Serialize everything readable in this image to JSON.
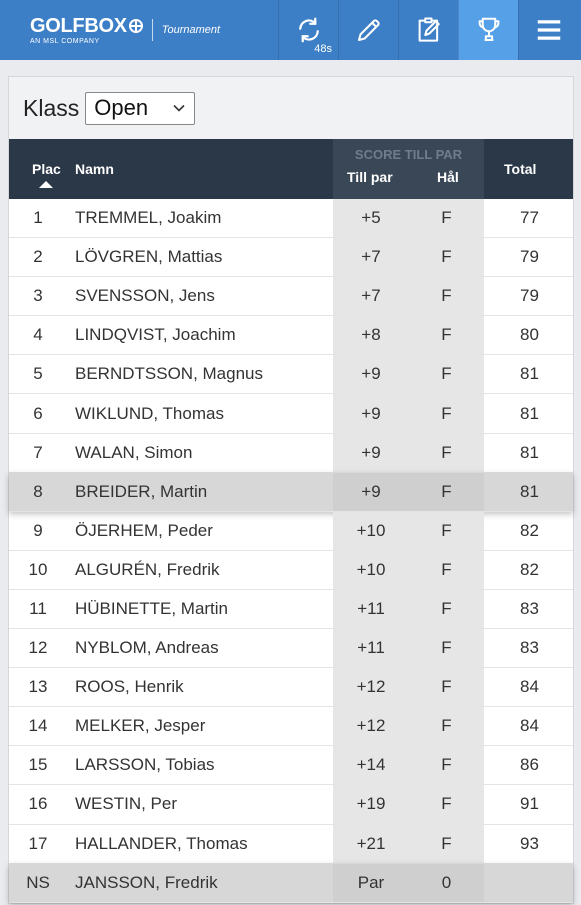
{
  "header": {
    "brand_name": "GOLFBOX",
    "brand_sub": "AN MSL COMPANY",
    "product": "Tournament",
    "refresh_count": "48s"
  },
  "filter": {
    "label": "Klass",
    "selected": "Open"
  },
  "table": {
    "columns": {
      "plac": "Plac",
      "namn": "Namn",
      "group": "SCORE TILL PAR",
      "till_par": "Till par",
      "hal": "Hål",
      "total": "Total"
    },
    "rows": [
      {
        "place": "1",
        "name": "TREMMEL, Joakim",
        "to_par": "+5",
        "hole": "F",
        "total": "77"
      },
      {
        "place": "2",
        "name": "LÖVGREN, Mattias",
        "to_par": "+7",
        "hole": "F",
        "total": "79"
      },
      {
        "place": "3",
        "name": "SVENSSON, Jens",
        "to_par": "+7",
        "hole": "F",
        "total": "79"
      },
      {
        "place": "4",
        "name": "LINDQVIST, Joachim",
        "to_par": "+8",
        "hole": "F",
        "total": "80"
      },
      {
        "place": "5",
        "name": "BERNDTSSON, Magnus",
        "to_par": "+9",
        "hole": "F",
        "total": "81"
      },
      {
        "place": "6",
        "name": "WIKLUND, Thomas",
        "to_par": "+9",
        "hole": "F",
        "total": "81"
      },
      {
        "place": "7",
        "name": "WALAN, Simon",
        "to_par": "+9",
        "hole": "F",
        "total": "81"
      },
      {
        "place": "8",
        "name": "BREIDER, Martin",
        "to_par": "+9",
        "hole": "F",
        "total": "81"
      },
      {
        "place": "9",
        "name": "ÖJERHEM, Peder",
        "to_par": "+10",
        "hole": "F",
        "total": "82"
      },
      {
        "place": "10",
        "name": "ALGURÉN, Fredrik",
        "to_par": "+10",
        "hole": "F",
        "total": "82"
      },
      {
        "place": "11",
        "name": "HÜBINETTE, Martin",
        "to_par": "+11",
        "hole": "F",
        "total": "83"
      },
      {
        "place": "12",
        "name": "NYBLOM, Andreas",
        "to_par": "+11",
        "hole": "F",
        "total": "83"
      },
      {
        "place": "13",
        "name": "ROOS, Henrik",
        "to_par": "+12",
        "hole": "F",
        "total": "84"
      },
      {
        "place": "14",
        "name": "MELKER, Jesper",
        "to_par": "+12",
        "hole": "F",
        "total": "84"
      },
      {
        "place": "15",
        "name": "LARSSON, Tobias",
        "to_par": "+14",
        "hole": "F",
        "total": "86"
      },
      {
        "place": "16",
        "name": "WESTIN, Per",
        "to_par": "+19",
        "hole": "F",
        "total": "91"
      },
      {
        "place": "17",
        "name": "HALLANDER, Thomas",
        "to_par": "+21",
        "hole": "F",
        "total": "93"
      },
      {
        "place": "NS",
        "name": "JANSSON, Fredrik",
        "to_par": "Par",
        "hole": "0",
        "total": ""
      }
    ],
    "highlighted_rows": [
      7,
      17
    ]
  },
  "colors": {
    "header_bg": "#3d7fc6",
    "active_nav_bg": "#55a0e6",
    "table_header_bg": "#2b3847"
  },
  "icons": [
    "refresh-icon",
    "pencil-icon",
    "scorecard-icon",
    "trophy-icon",
    "menu-icon",
    "chevron-down-icon",
    "sort-asc-icon"
  ]
}
